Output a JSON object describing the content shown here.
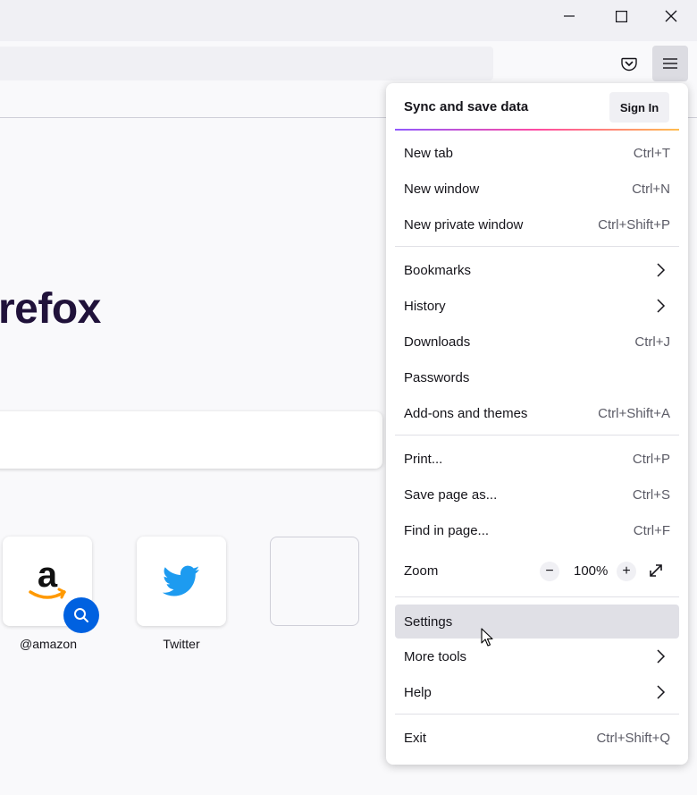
{
  "window": {
    "controls": [
      "minimize-icon",
      "maximize-icon",
      "close-icon"
    ]
  },
  "toolbar": {
    "pocket_icon": "pocket-icon",
    "menu_icon": "hamburger-menu-icon"
  },
  "newtab": {
    "brand": "refox",
    "shortcuts": [
      {
        "label": "@amazon",
        "icon": "amazon-logo"
      },
      {
        "label": "Twitter",
        "icon": "twitter-logo"
      },
      {
        "label": "",
        "icon": ""
      }
    ]
  },
  "menu": {
    "sync_title": "Sync and save data",
    "sign_in": "Sign In",
    "items": [
      {
        "label": "New tab",
        "shortcut": "Ctrl+T"
      },
      {
        "label": "New window",
        "shortcut": "Ctrl+N"
      },
      {
        "label": "New private window",
        "shortcut": "Ctrl+Shift+P"
      },
      {
        "label": "Bookmarks",
        "shortcut": ""
      },
      {
        "label": "History",
        "shortcut": ""
      },
      {
        "label": "Downloads",
        "shortcut": "Ctrl+J"
      },
      {
        "label": "Passwords",
        "shortcut": ""
      },
      {
        "label": "Add-ons and themes",
        "shortcut": "Ctrl+Shift+A"
      },
      {
        "label": "Print...",
        "shortcut": "Ctrl+P"
      },
      {
        "label": "Save page as...",
        "shortcut": "Ctrl+S"
      },
      {
        "label": "Find in page...",
        "shortcut": "Ctrl+F"
      },
      {
        "label": "Zoom",
        "shortcut": ""
      },
      {
        "label": "Settings",
        "shortcut": ""
      },
      {
        "label": "More tools",
        "shortcut": ""
      },
      {
        "label": "Help",
        "shortcut": ""
      },
      {
        "label": "Exit",
        "shortcut": "Ctrl+Shift+Q"
      }
    ],
    "zoom": {
      "minus": "−",
      "value": "100%",
      "plus": "+"
    },
    "highlighted": "Settings"
  },
  "colors": {
    "accent": "#0061e0",
    "twitter": "#1d9bf0",
    "amazon_orange": "#ff9900",
    "brand": "#20123a"
  }
}
